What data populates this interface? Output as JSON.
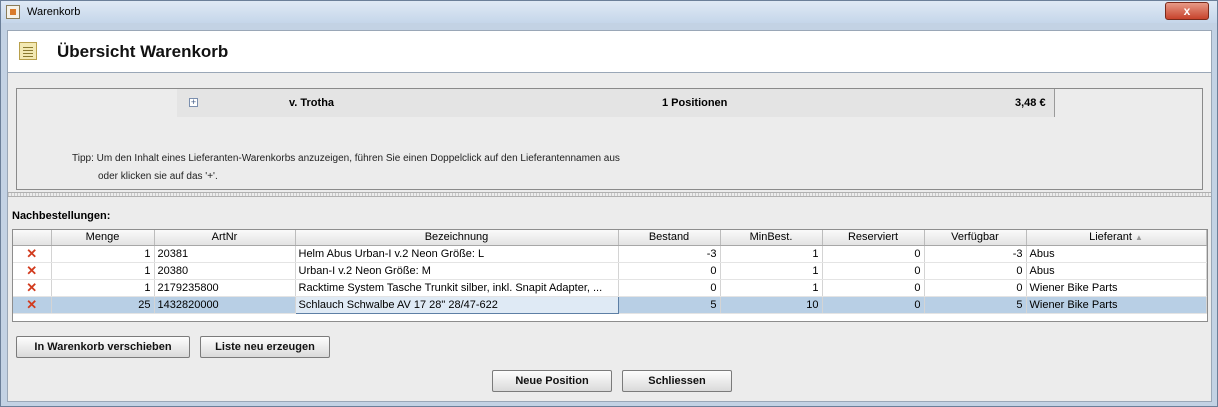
{
  "window": {
    "title": "Warenkorb",
    "close_label": "x"
  },
  "header": {
    "title": "Übersicht Warenkorb"
  },
  "supplier": {
    "expand": "+",
    "name": "v. Trotha",
    "positions": "1 Positionen",
    "sum": "3,48 €"
  },
  "tip": {
    "line1": "Tipp:  Um den Inhalt eines Lieferanten-Warenkorbs anzuzeigen, führen Sie einen Doppelclick auf den Lieferantennamen aus",
    "line2": "oder klicken sie auf das '+'."
  },
  "reorders": {
    "label": "Nachbestellungen:",
    "columns": [
      "",
      "Menge",
      "ArtNr",
      "Bezeichnung",
      "Bestand",
      "MinBest.",
      "Reserviert",
      "Verfügbar",
      "Lieferant"
    ],
    "rows": [
      {
        "delete": "✕",
        "menge": "1",
        "artnr": "20381",
        "bezeichnung": "Helm Abus Urban-I v.2 Neon Größe: L",
        "bestand": "-3",
        "minbest": "1",
        "reserviert": "0",
        "verfuegbar": "-3",
        "lieferant": "Abus"
      },
      {
        "delete": "✕",
        "menge": "1",
        "artnr": "20380",
        "bezeichnung": "Urban-I v.2 Neon Größe: M",
        "bestand": "0",
        "minbest": "1",
        "reserviert": "0",
        "verfuegbar": "0",
        "lieferant": "Abus"
      },
      {
        "delete": "✕",
        "menge": "1",
        "artnr": "2179235800",
        "bezeichnung": "Racktime System Tasche Trunkit silber, inkl. Snapit Adapter, ...",
        "bestand": "0",
        "minbest": "1",
        "reserviert": "0",
        "verfuegbar": "0",
        "lieferant": "Wiener Bike Parts"
      },
      {
        "delete": "✕",
        "menge": "25",
        "artnr": "1432820000",
        "bezeichnung": "Schlauch Schwalbe AV 17 28\" 28/47-622",
        "bestand": "5",
        "minbest": "10",
        "reserviert": "0",
        "verfuegbar": "5",
        "lieferant": "Wiener Bike Parts"
      }
    ]
  },
  "buttons": {
    "move_to_cart": "In Warenkorb verschieben",
    "regenerate_list": "Liste neu erzeugen",
    "new_position": "Neue Position",
    "close": "Schliessen"
  },
  "colors": {
    "selection": "#b8cfe5",
    "delete": "#d23b1e",
    "titlebar": "#c5d6ea"
  }
}
